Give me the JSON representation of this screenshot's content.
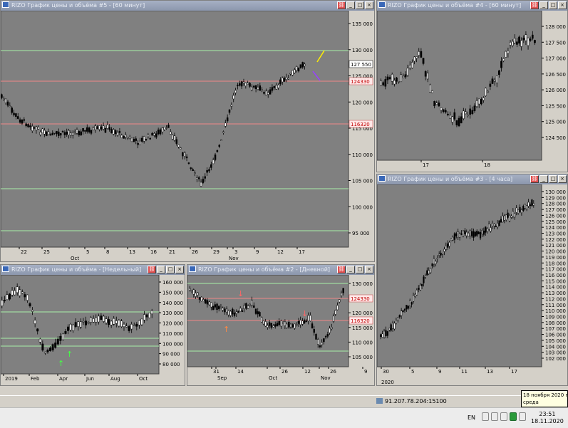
{
  "windows": {
    "w5": {
      "title": "RIZO График цены и объёма #5 - [60 минут]"
    },
    "w4": {
      "title": "RIZO График цены и объёма #4 - [60 минут]"
    },
    "w3": {
      "title": "RIZO График цены и объёма #3 - [4 часа]"
    },
    "w1": {
      "title": "RIZO График цены и объёма - [Недельный]"
    },
    "w2": {
      "title": "RIZO График цены и объёма #2 - [Дневной]"
    }
  },
  "charts": {
    "w5": {
      "price_axis": [
        "135 000",
        "130 000",
        "125 000",
        "120 000",
        "115 000",
        "110 000",
        "105 000",
        "100 000",
        "95 000"
      ],
      "current_price": "127 550",
      "level_labels": [
        "124330",
        "116320"
      ],
      "date_axis": [
        "22",
        "25",
        "Oct",
        "5",
        "8",
        "13",
        "16",
        "21",
        "26",
        "29",
        "3",
        "Nov",
        "9",
        "12",
        "17"
      ]
    },
    "w4": {
      "price_axis": [
        "128 000",
        "127 500",
        "127 000",
        "126 500",
        "126 000",
        "125 500",
        "125 000",
        "124 500"
      ],
      "date_axis": [
        "17",
        "18"
      ]
    },
    "w3": {
      "price_axis": [
        "130 000",
        "129 000",
        "128 000",
        "127 000",
        "126 000",
        "125 000",
        "124 000",
        "123 000",
        "122 000",
        "121 000",
        "120 000",
        "119 000",
        "118 000",
        "117 000",
        "116 000",
        "115 000",
        "114 000",
        "113 000",
        "112 000",
        "111 000",
        "110 000",
        "109 000",
        "108 000",
        "107 000",
        "106 000",
        "105 000",
        "104 000",
        "103 000",
        "102 000"
      ],
      "date_axis": [
        "30",
        "5",
        "9",
        "11",
        "13",
        "17"
      ],
      "year_label": "2020"
    },
    "w1": {
      "price_axis": [
        "160 000",
        "150 000",
        "140 000",
        "130 000",
        "120 000",
        "110 000",
        "100 000",
        "90 000",
        "80 000"
      ],
      "date_axis": [
        "2019",
        "Feb",
        "Apr",
        "Jun",
        "Aug",
        "Oct"
      ]
    },
    "w2": {
      "price_axis": [
        "130 000",
        "125 000",
        "120 000",
        "115 000",
        "110 000",
        "105 000"
      ],
      "level_labels": [
        "124330",
        "116320"
      ],
      "date_axis": [
        "31",
        "14",
        "26",
        "12",
        "26",
        "9",
        "Sep",
        "Oct",
        "Nov"
      ]
    }
  },
  "status": {
    "connection": "91.207.78.204:15100"
  },
  "taskbar": {
    "lang": "EN",
    "time": "23:51",
    "date": "18.11.2020",
    "tooltip_date": "18 ноября 2020 г.",
    "tooltip_day": "среда"
  },
  "colors": {
    "chart_bg": "#808080",
    "green_level": "#a8f0a8",
    "red_level": "#f08888",
    "candle_up": "#ffffff",
    "candle_down": "#000000"
  }
}
